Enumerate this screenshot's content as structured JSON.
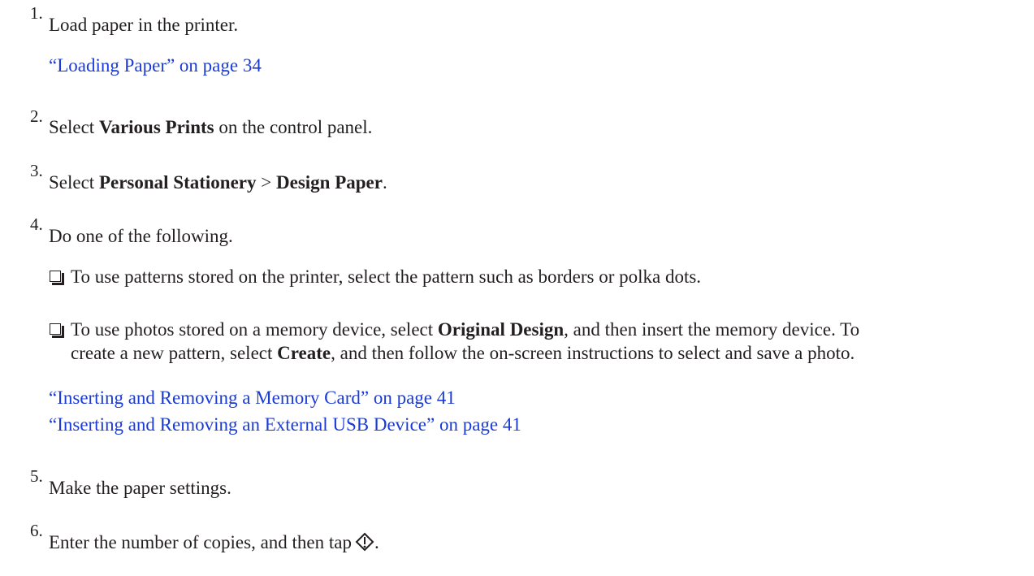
{
  "steps": [
    {
      "number": "1.",
      "text": "Load paper in the printer.",
      "link": "“Loading Paper” on page 34"
    },
    {
      "number": "2.",
      "pre": "Select ",
      "bold": "Various Prints",
      "post": " on the control panel."
    },
    {
      "number": "3.",
      "pre": "Select ",
      "bold1": "Personal Stationery",
      "mid": " > ",
      "bold2": "Design Paper",
      "post": "."
    },
    {
      "number": "4.",
      "text": "Do one of the following.",
      "option1": "To use patterns stored on the printer, select the pattern such as borders or polka dots.",
      "option2": {
        "pre": "To use photos stored on a memory device, select ",
        "bold1": "Original Design",
        "mid": ", and then insert the memory device. To",
        "line2_pre": "create a new pattern, select ",
        "bold2": "Create",
        "line2_post": ", and then follow the on-screen instructions to select and save a photo."
      },
      "link1": "“Inserting and Removing a Memory Card” on page 41",
      "link2": "“Inserting and Removing an External USB Device” on page 41"
    },
    {
      "number": "5.",
      "text": "Make the paper settings."
    },
    {
      "number": "6.",
      "text": "Enter the number of copies, and then tap",
      "end": ".",
      "icon": "start-icon"
    }
  ],
  "colors": {
    "text": "#231f20",
    "link": "#1a3bd6"
  }
}
